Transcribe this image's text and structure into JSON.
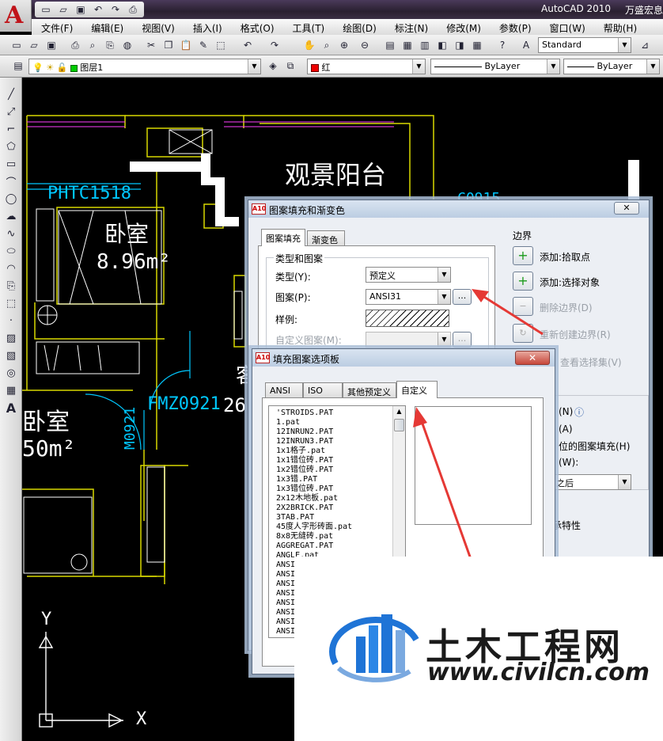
{
  "app": {
    "logo": "A",
    "title": "AutoCAD 2010",
    "title_right": "万盛宏息"
  },
  "menu": [
    "文件(F)",
    "编辑(E)",
    "视图(V)",
    "插入(I)",
    "格式(O)",
    "工具(T)",
    "绘图(D)",
    "标注(N)",
    "修改(M)",
    "参数(P)",
    "窗口(W)",
    "帮助(H)"
  ],
  "toolbar": {
    "text_style": "Standard",
    "layer": "图层1",
    "color": "红",
    "linetype": "ByLayer",
    "lineweight": "ByLayer",
    "icons": [
      "new-icon",
      "open-icon",
      "save-icon",
      "plot-icon",
      "preview-icon",
      "publish-icon",
      "3d-icon",
      "cut-icon",
      "copy-icon",
      "paste-icon",
      "match-icon",
      "block-icon",
      "undo-icon",
      "redo-icon",
      "pan-icon",
      "zoom-realtime-icon",
      "zoom-window-icon",
      "zoom-previous-icon",
      "properties-icon",
      "design-center-icon",
      "tool-palette-icon",
      "sheetset-icon",
      "markup-icon",
      "calc-icon",
      "help-icon"
    ]
  },
  "drawing": {
    "labels": {
      "balcony": "观景阳台",
      "window_code": "PHTC1518",
      "room1": "卧室",
      "area1": "8.96m²",
      "c_code": "C0915",
      "room2": "卧室",
      "area2": "50m²",
      "door1": "M0921",
      "door2": "FMZ0921",
      "num": "26",
      "room3": "客",
      "axis_x": "X",
      "axis_y": "Y"
    }
  },
  "hatch_dialog": {
    "title": "图案填充和渐变色",
    "tabs": [
      "图案填充",
      "渐变色"
    ],
    "group_type": "类型和图案",
    "type_label": "类型(Y):",
    "type_value": "预定义",
    "pattern_label": "图案(P):",
    "pattern_value": "ANSI31",
    "browse": "...",
    "sample_label": "样例:",
    "custom_label": "自定义图案(M):",
    "boundary_group": "边界",
    "add_pick": "添加:拾取点",
    "add_select": "添加:选择对象",
    "remove_boundary": "删除边界(D)",
    "recreate_boundary": "重新创建边界(R)",
    "view_select": "查看选择集(V)",
    "right_partial": [
      "(N)",
      "(A)",
      "位的图案填充(H)",
      "(W):",
      "之后",
      "承特性"
    ]
  },
  "palette_dialog": {
    "title": "填充图案选项板",
    "tabs": [
      "ANSI",
      "ISO",
      "其他预定义",
      "自定义"
    ],
    "patterns": [
      "'STROIDS.PAT",
      "1.pat",
      "12INRUN2.PAT",
      "12INRUN3.PAT",
      "1x1格子.pat",
      "1x1错位砖.PAT",
      "1x2错位砖.PAT",
      "1x3错.PAT",
      "1x3错位砖.PAT",
      "2x12木地板.pat",
      "2X2BRICK.PAT",
      "3TAB.PAT",
      "45度人字形砖面.pat",
      "8x8无缝砖.pat",
      "AGGREGAT.PAT",
      "ANGLE.pat",
      "ANSI",
      "ANSI",
      "ANSI",
      "ANSI",
      "ANSI",
      "ANSI",
      "ANSI",
      "ANSI"
    ]
  },
  "watermark": {
    "name": "土木工程网",
    "url": "www.civilcn.com"
  },
  "colors": {
    "accent_red": "#e53935",
    "cad_yellow": "#d8d800",
    "cad_cyan": "#00c8ff",
    "cad_magenta": "#ff40ff",
    "logo_blue": "#1f74d6"
  }
}
